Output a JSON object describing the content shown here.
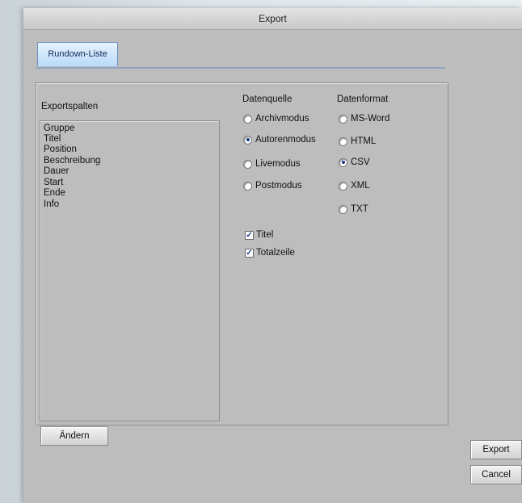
{
  "window": {
    "title": "Export"
  },
  "tabs": [
    {
      "label": "Rundown-Liste"
    }
  ],
  "columns_section": {
    "label": "Exportspalten",
    "items": [
      "Gruppe",
      "Titel",
      "Position",
      "Beschreibung",
      "Dauer",
      "Start",
      "Ende",
      "Info"
    ]
  },
  "source": {
    "label": "Datenquelle",
    "options": [
      {
        "label": "Archivmodus",
        "selected": false
      },
      {
        "label": "Autorenmodus",
        "selected": true
      },
      {
        "label": "Livemodus",
        "selected": false
      },
      {
        "label": "Postmodus",
        "selected": false
      }
    ]
  },
  "format": {
    "label": "Datenformat",
    "options": [
      {
        "label": "MS-Word",
        "selected": false
      },
      {
        "label": "HTML",
        "selected": false
      },
      {
        "label": "CSV",
        "selected": true
      },
      {
        "label": "XML",
        "selected": false
      },
      {
        "label": "TXT",
        "selected": false
      }
    ]
  },
  "checks": [
    {
      "label": "Titel",
      "checked": true
    },
    {
      "label": "Totalzeile",
      "checked": true
    }
  ],
  "buttons": {
    "change": "Ändern",
    "export": "Export",
    "cancel": "Cancel"
  }
}
